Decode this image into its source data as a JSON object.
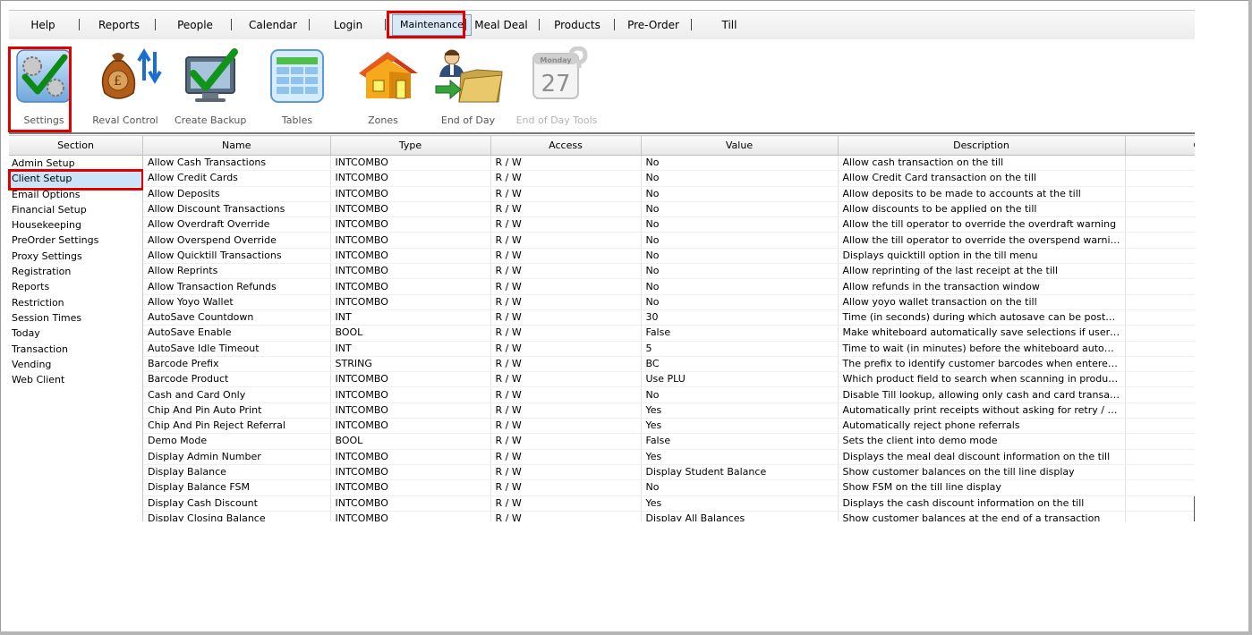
{
  "menu": {
    "items": [
      "Help",
      "Reports",
      "People",
      "Calendar",
      "Login",
      "Maintenance",
      "Meal Deal",
      "Products",
      "Pre-Order",
      "Till"
    ],
    "active": "Maintenance"
  },
  "toolbar": {
    "settings": "Settings",
    "reval_control": "Reval Control",
    "create_backup": "Create Backup",
    "tables": "Tables",
    "zones": "Zones",
    "end_of_day": "End of Day",
    "end_of_day_tools": "End of Day Tools",
    "calendar_icon_day": "Monday",
    "calendar_icon_date": "27"
  },
  "sections": {
    "header": "Section",
    "items": [
      "Admin Setup",
      "Client Setup",
      "Email Options",
      "Financial Setup",
      "Housekeeping",
      "PreOrder Settings",
      "Proxy Settings",
      "Registration",
      "Reports",
      "Restriction",
      "Session Times",
      "Today",
      "Transaction",
      "Vending",
      "Web Client"
    ],
    "selected": "Client Setup"
  },
  "grid": {
    "columns": [
      "Name",
      "Type",
      "Access",
      "Value",
      "Description",
      "C"
    ],
    "rows": [
      [
        "Allow Cash Transactions",
        "INTCOMBO",
        "R / W",
        "No",
        "Allow cash transaction on the till"
      ],
      [
        "Allow Credit Cards",
        "INTCOMBO",
        "R / W",
        "No",
        "Allow Credit Card transaction on the till"
      ],
      [
        "Allow Deposits",
        "INTCOMBO",
        "R / W",
        "No",
        "Allow deposits to be made to accounts at the till"
      ],
      [
        "Allow Discount Transactions",
        "INTCOMBO",
        "R / W",
        "No",
        "Allow discounts to be applied on the till"
      ],
      [
        "Allow Overdraft Override",
        "INTCOMBO",
        "R / W",
        "No",
        "Allow the till operator to override the overdraft warning"
      ],
      [
        "Allow Overspend Override",
        "INTCOMBO",
        "R / W",
        "No",
        "Allow the till operator to override the overspend warning"
      ],
      [
        "Allow Quicktill Transactions",
        "INTCOMBO",
        "R / W",
        "No",
        "Displays quicktill option in the till menu"
      ],
      [
        "Allow Reprints",
        "INTCOMBO",
        "R / W",
        "No",
        "Allow reprinting of the last receipt at the till"
      ],
      [
        "Allow Transaction Refunds",
        "INTCOMBO",
        "R / W",
        "No",
        "Allow refunds in the transaction window"
      ],
      [
        "Allow Yoyo Wallet",
        "INTCOMBO",
        "R / W",
        "No",
        "Allow yoyo wallet transaction on the till"
      ],
      [
        "AutoSave Countdown",
        "INT",
        "R / W",
        "30",
        "Time (in seconds) during which autosave can be postponed"
      ],
      [
        "AutoSave Enable",
        "BOOL",
        "R / W",
        "False",
        "Make whiteboard automatically save selections if user does n..."
      ],
      [
        "AutoSave Idle Timeout",
        "INT",
        "R / W",
        "5",
        "Time to wait (in minutes) before the whiteboard automaticall..."
      ],
      [
        "Barcode Prefix",
        "STRING",
        "R / W",
        "BC",
        "The prefix to identify customer barcodes when entered at th..."
      ],
      [
        "Barcode Product",
        "INTCOMBO",
        "R / W",
        "Use PLU",
        "Which product field to search when scanning in products at t..."
      ],
      [
        "Cash and Card Only",
        "INTCOMBO",
        "R / W",
        "No",
        "Disable Till lookup, allowing only cash and card transaction"
      ],
      [
        "Chip And Pin Auto Print",
        "INTCOMBO",
        "R / W",
        "Yes",
        "Automatically print receipts without asking for retry / continue"
      ],
      [
        "Chip And Pin Reject Referral",
        "INTCOMBO",
        "R / W",
        "Yes",
        "Automatically reject phone referrals"
      ],
      [
        "Demo Mode",
        "BOOL",
        "R / W",
        "False",
        "Sets the client into demo mode"
      ],
      [
        "Display Admin Number",
        "INTCOMBO",
        "R / W",
        "Yes",
        "Displays the meal deal discount information on the till"
      ],
      [
        "Display Balance",
        "INTCOMBO",
        "R / W",
        "Display Student Balance",
        "Show customer balances on the till line display"
      ],
      [
        "Display Balance FSM",
        "INTCOMBO",
        "R / W",
        "No",
        "Show FSM on the till line display"
      ],
      [
        "Display Cash Discount",
        "INTCOMBO",
        "R / W",
        "Yes",
        "Displays the cash discount information on the till"
      ],
      [
        "Display Closing Balance",
        "INTCOMBO",
        "R / W",
        "Display All Balances",
        "Show customer balances at the end of a transaction"
      ]
    ]
  }
}
